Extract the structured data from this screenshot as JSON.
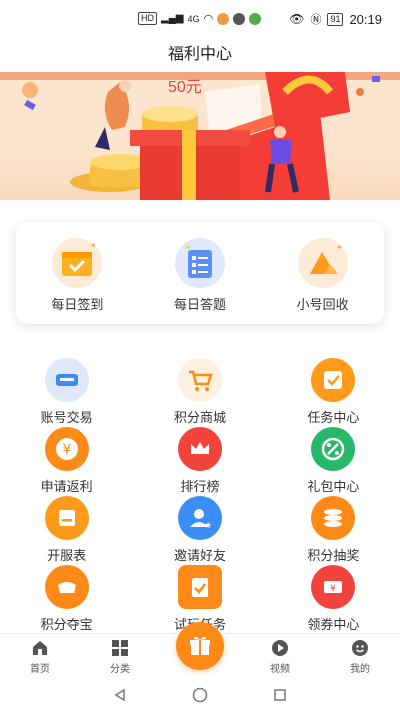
{
  "status_bar": {
    "network": "HD",
    "wifi": "4G",
    "battery": "91",
    "time": "20:19"
  },
  "page": {
    "title": "福利中心"
  },
  "banner": {
    "badge_text": "50元"
  },
  "quick_actions": [
    {
      "label": "每日签到",
      "icon": "calendar-check-icon"
    },
    {
      "label": "每日答题",
      "icon": "quiz-sheet-icon"
    },
    {
      "label": "小号回收",
      "icon": "recycle-triangle-icon"
    }
  ],
  "grid": [
    {
      "label": "账号交易",
      "icon": "account-trade-icon",
      "color": "#3a8ef5"
    },
    {
      "label": "积分商城",
      "icon": "cart-icon",
      "color": "#ff8a18"
    },
    {
      "label": "任务中心",
      "icon": "task-check-icon",
      "color": "#ff9a1a"
    },
    {
      "label": "申请返利",
      "icon": "yen-coin-icon",
      "color": "#ff8a18"
    },
    {
      "label": "排行榜",
      "icon": "crown-icon",
      "color": "#f2433c"
    },
    {
      "label": "礼包中心",
      "icon": "gift-percent-icon",
      "color": "#27b86a"
    },
    {
      "label": "开服表",
      "icon": "server-list-icon",
      "color": "#ff9a1a"
    },
    {
      "label": "邀请好友",
      "icon": "invite-user-icon",
      "color": "#3a8ef5"
    },
    {
      "label": "积分抽奖",
      "icon": "coin-stack-icon",
      "color": "#ff8a18"
    },
    {
      "label": "积分夺宝",
      "icon": "treasure-icon",
      "color": "#ff8a18"
    },
    {
      "label": "试玩任务",
      "icon": "clipboard-check-icon",
      "color": "#ff8a18"
    },
    {
      "label": "领券中心",
      "icon": "coupon-icon",
      "color": "#f2433c"
    }
  ],
  "tabbar": [
    {
      "label": "首页",
      "icon": "home-icon"
    },
    {
      "label": "分类",
      "icon": "category-grid-icon"
    },
    {
      "label": "",
      "icon": "gift-fab-icon"
    },
    {
      "label": "视频",
      "icon": "play-icon"
    },
    {
      "label": "我的",
      "icon": "profile-smile-icon"
    }
  ],
  "colors": {
    "accent": "#ff8a18",
    "banner_bg": "#fde6cf"
  }
}
